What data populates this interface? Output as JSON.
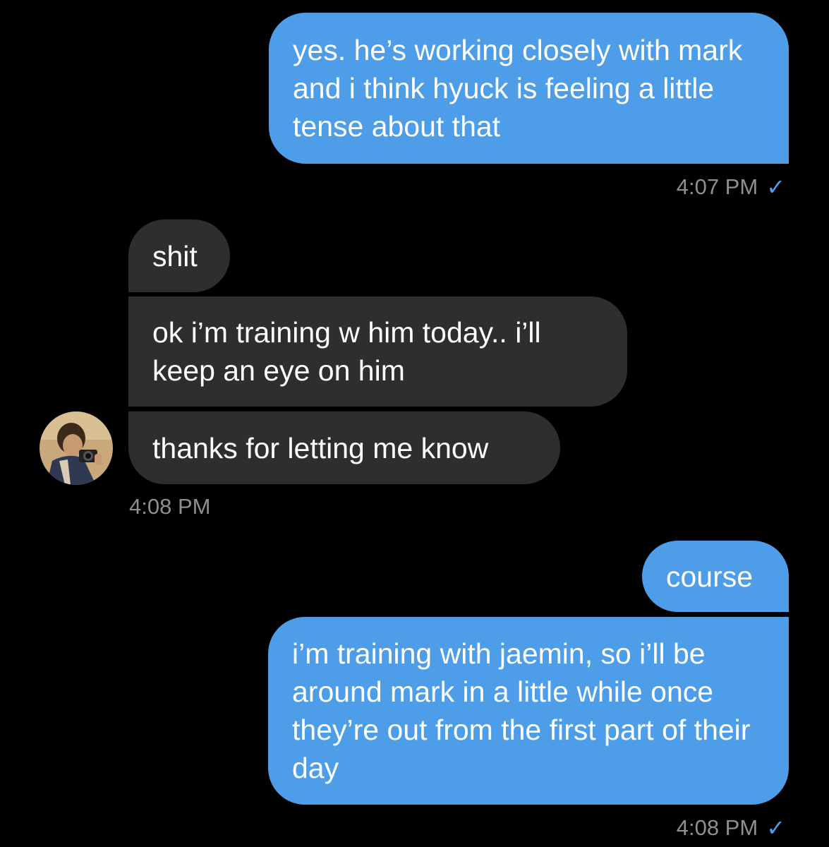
{
  "messages": [
    {
      "text": "yes. he’s working closely with mark and i think hyuck is feeling a little tense about that"
    },
    {
      "text": "shit"
    },
    {
      "text": "ok i’m training w him today.. i’ll keep an eye on him"
    },
    {
      "text": "thanks for letting me know"
    },
    {
      "text": "course"
    },
    {
      "text": "i’m training with jaemin, so i’ll be around mark in a little while once they’re out from the first part of their day"
    }
  ],
  "timestamps": {
    "first_out": "4:07 PM",
    "incoming": "4:08 PM",
    "last_out": "4:08 PM"
  },
  "status": {
    "check_icon": "✓"
  },
  "colors": {
    "background": "#000000",
    "outgoing_bubble": "#4e9de8",
    "incoming_bubble": "#2c2e30",
    "timestamp": "#8e8e93"
  }
}
